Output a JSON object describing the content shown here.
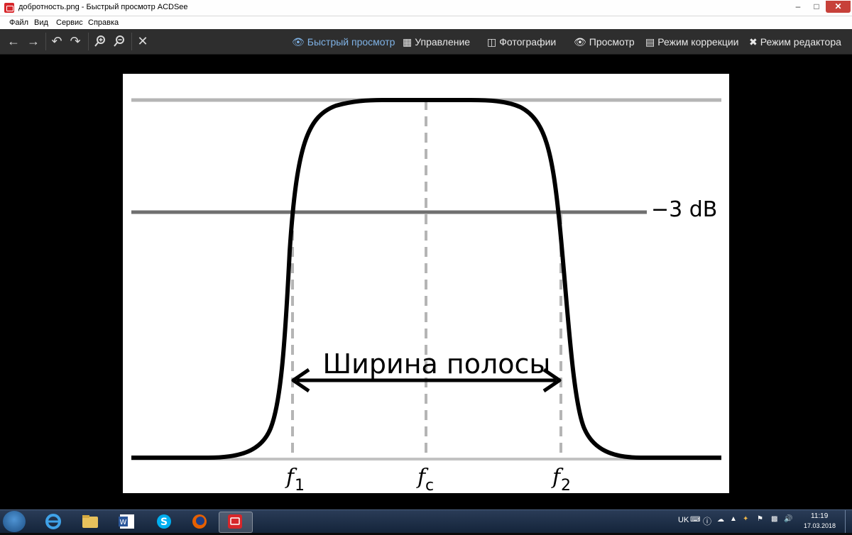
{
  "window": {
    "title": "добротность.png - Быстрый просмотр ACDSee",
    "controls": {
      "minimize": "–",
      "maximize": "□",
      "close": "✕"
    }
  },
  "menu": [
    "Файл",
    "Вид",
    "Сервис",
    "Справка"
  ],
  "toolbar": {
    "nav_icons": [
      "arrow-left-icon",
      "arrow-right-icon",
      "rotate-left-icon",
      "rotate-right-icon",
      "zoom-in-icon",
      "zoom-out-icon",
      "close-icon"
    ],
    "mode_tabs": [
      {
        "label": "Быстрый просмотр",
        "icon": "eye-icon",
        "active": true
      },
      {
        "label": "Управление",
        "icon": "grid-icon",
        "active": false
      },
      {
        "label": "Фотографии",
        "icon": "photos-icon",
        "active": false
      },
      {
        "label": "Просмотр",
        "icon": "eye-icon",
        "active": false
      },
      {
        "label": "Режим коррекции",
        "icon": "develop-icon",
        "active": false
      },
      {
        "label": "Режим редактора",
        "icon": "edit-icon",
        "active": false
      }
    ]
  },
  "image": {
    "level_label": "−3 dB",
    "band_label": "Ширина полосы",
    "markers": [
      {
        "base": "f",
        "sub": "1"
      },
      {
        "base": "f",
        "sub": "c"
      },
      {
        "base": "f",
        "sub": "2"
      }
    ]
  },
  "taskbar": {
    "apps": [
      "start-orb-icon",
      "internet-explorer-icon",
      "file-explorer-icon",
      "word-icon",
      "skype-icon",
      "firefox-icon",
      "acdsee-icon"
    ],
    "active_app": "acdsee-icon",
    "language": "UK",
    "time": "11:19",
    "date": "17.03.2018"
  },
  "colors": {
    "toolbar_bg": "#2e2e2e",
    "active_tab": "#7fb2e5",
    "close_button": "#c7413a",
    "taskbar": "#1d3150"
  }
}
